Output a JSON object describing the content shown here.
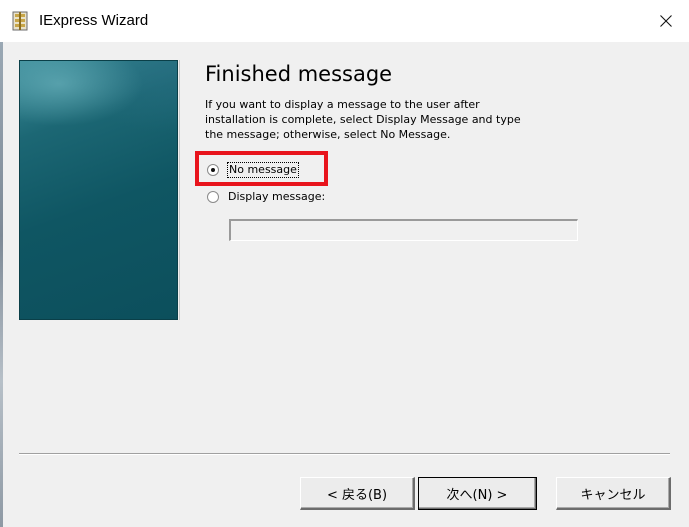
{
  "window": {
    "title": "IExpress Wizard",
    "title_icon": "iexpress-package-icon",
    "close_icon": "close-icon"
  },
  "page": {
    "heading": "Finished message",
    "description_lines": [
      "If you want to display a message to the user after",
      "installation is complete, select Display Message and type",
      "the message; otherwise, select No Message."
    ]
  },
  "options": {
    "no_message": {
      "label": "No message",
      "checked": true
    },
    "display_message": {
      "label": "Display message:",
      "checked": false
    }
  },
  "message_input": {
    "value": "",
    "enabled": false
  },
  "buttons": {
    "back": "< 戻る(B)",
    "next": "次へ(N) >",
    "cancel": "キャンセル"
  },
  "colors": {
    "highlight_box": "#e8141c",
    "banner_teal": "#0f5663"
  }
}
